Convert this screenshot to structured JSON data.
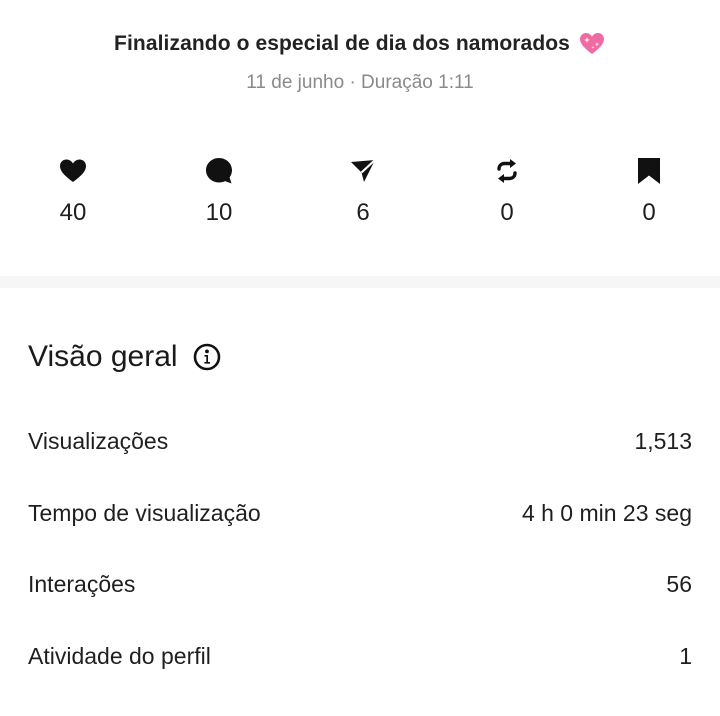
{
  "post": {
    "title": "Finalizando o especial de dia dos namorados",
    "title_emoji": "sparkling-heart-icon",
    "date": "11 de junho",
    "separator": "·",
    "duration_label": "Duração",
    "duration_value": "1:11"
  },
  "stats": [
    {
      "icon": "heart-icon",
      "value": "40"
    },
    {
      "icon": "comment-icon",
      "value": "10"
    },
    {
      "icon": "share-icon",
      "value": "6"
    },
    {
      "icon": "repost-icon",
      "value": "0"
    },
    {
      "icon": "bookmark-icon",
      "value": "0"
    }
  ],
  "overview": {
    "title": "Visão geral",
    "rows": [
      {
        "label": "Visualizações",
        "value": "1,513"
      },
      {
        "label": "Tempo de visualização",
        "value": "4 h 0 min 23 seg"
      },
      {
        "label": "Interações",
        "value": "56"
      },
      {
        "label": "Atividade do perfil",
        "value": "1"
      }
    ]
  },
  "colors": {
    "text": "#1b1b1b",
    "muted": "#8a8a8a",
    "divider": "#f6f6f6",
    "emoji_pink": "#f06ba5"
  }
}
